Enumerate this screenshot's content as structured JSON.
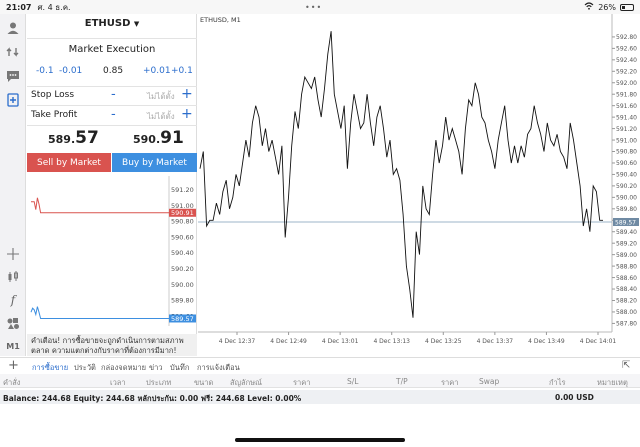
{
  "status": {
    "time": "21:07",
    "date": "ศ. 4 ธ.ค.",
    "battery": "26%",
    "dots": "•••"
  },
  "panel": {
    "symbol": "ETHUSD",
    "execution": "Market Execution",
    "vol_buttons": [
      "-0.1",
      "-0.01",
      "0.85",
      "+0.01",
      "+0.1"
    ],
    "stop_loss": {
      "label": "Stop Loss",
      "placeholder": "ไม่ได้ตั้ง",
      "minus": "-",
      "plus": "+"
    },
    "take_profit": {
      "label": "Take Profit",
      "placeholder": "ไม่ได้ตั้ง",
      "minus": "-",
      "plus": "+"
    },
    "sell_price": {
      "main": "589.",
      "big": "57"
    },
    "buy_price": {
      "main": "590.",
      "big": "91"
    },
    "sell_label": "Sell by Market",
    "buy_label": "Buy by Market",
    "warning": "คำเตือน! การซื้อขายจะถูกดำเนินการตามสภาพตลาด ความแตกต่างกับราคาที่ต้องการมีมาก!"
  },
  "mini_chart": {
    "ticks": [
      "591.20",
      "591.00",
      "590.80",
      "590.60",
      "590.40",
      "590.20",
      "590.00",
      "589.80",
      "589.60"
    ],
    "ask_label": "590.91",
    "bid_label": "589.57",
    "ylim": [
      589.5,
      591.3
    ],
    "ask_series": [
      591.05,
      591.05,
      591.05,
      590.95,
      591.1,
      591.02,
      590.91,
      590.91,
      590.91,
      590.91,
      590.91,
      590.91,
      590.91,
      590.91,
      590.91,
      590.91,
      590.91,
      590.91,
      590.91,
      590.91,
      590.91,
      590.91,
      590.91,
      590.91,
      590.91,
      590.91,
      590.91,
      590.91,
      590.91,
      590.91,
      590.91
    ],
    "bid_series": [
      589.65,
      589.7,
      589.68,
      589.62,
      589.72,
      589.65,
      589.57,
      589.57,
      589.57,
      589.57,
      589.57,
      589.57,
      589.57,
      589.57,
      589.57,
      589.57,
      589.57,
      589.57,
      589.57,
      589.57,
      589.57,
      589.57,
      589.57,
      589.57,
      589.57,
      589.57,
      589.57,
      589.57,
      589.57,
      589.57,
      589.57
    ],
    "ask_color": "#d9534f",
    "bid_color": "#3d8fe0"
  },
  "chart_data": {
    "type": "line",
    "title": "ETHUSD, M1",
    "ylim": [
      587.65,
      593.2
    ],
    "yticks": [
      "592.80",
      "592.60",
      "592.40",
      "592.20",
      "592.00",
      "591.80",
      "591.60",
      "591.40",
      "591.20",
      "591.00",
      "590.80",
      "590.60",
      "590.40",
      "590.20",
      "590.00",
      "589.80",
      "589.60",
      "589.40",
      "589.20",
      "589.00",
      "588.80",
      "588.60",
      "588.40",
      "588.20",
      "588.00",
      "587.80"
    ],
    "xticks": [
      "4 Dec 12:37",
      "4 Dec 12:49",
      "4 Dec 13:01",
      "4 Dec 13:13",
      "4 Dec 13:25",
      "4 Dec 13:37",
      "4 Dec 13:49",
      "4 Dec 14:01"
    ],
    "current_price": "589.57",
    "current_value": 589.57,
    "values": [
      590.5,
      590.8,
      589.5,
      589.6,
      589.6,
      589.9,
      589.7,
      590.1,
      590.3,
      589.8,
      590.0,
      590.4,
      590.2,
      590.6,
      591.0,
      590.7,
      591.3,
      591.6,
      591.4,
      590.9,
      591.2,
      590.8,
      591.0,
      590.7,
      590.4,
      590.9,
      589.3,
      590.0,
      590.9,
      591.5,
      591.2,
      591.8,
      592.1,
      592.0,
      591.9,
      592.1,
      591.7,
      591.4,
      591.9,
      592.5,
      592.9,
      591.8,
      591.5,
      591.2,
      591.6,
      590.5,
      591.3,
      591.8,
      591.5,
      591.2,
      591.3,
      591.8,
      591.3,
      590.9,
      591.4,
      591.6,
      591.2,
      590.7,
      591.0,
      590.4,
      590.5,
      590.3,
      589.7,
      588.8,
      588.4,
      587.9,
      589.4,
      589.0,
      590.2,
      589.8,
      589.7,
      590.4,
      591.0,
      590.6,
      590.9,
      591.4,
      591.0,
      591.2,
      591.0,
      590.8,
      590.4,
      591.2,
      591.7,
      591.6,
      592.0,
      591.8,
      591.4,
      591.3,
      591.0,
      590.8,
      590.5,
      591.0,
      591.3,
      591.6,
      591.0,
      590.6,
      590.9,
      590.6,
      590.9,
      590.7,
      591.1,
      591.2,
      591.6,
      591.3,
      591.1,
      590.8,
      591.3,
      591.0,
      590.9,
      591.1,
      590.8,
      590.7,
      590.5,
      591.3,
      591.0,
      590.6,
      590.2,
      589.5,
      589.8,
      589.4,
      590.2,
      590.1,
      589.6,
      589.6
    ],
    "line_color": "#111111",
    "price_line_color": "#9db4c8",
    "grid": false
  },
  "tabs": {
    "items": [
      "การซื้อขาย",
      "ประวัติ",
      "กล่องจดหมาย",
      "ข่าว",
      "บันทึก",
      "การแจ้งเตือน"
    ],
    "active": 0
  },
  "columns": [
    "คำสั่ง",
    "เวลา",
    "ประเภท",
    "ขนาด",
    "สัญลักษณ์",
    "ราคา",
    "S/L",
    "T/P",
    "ราคา",
    "Swap",
    "กำไร",
    "หมายเหตุ"
  ],
  "balance": {
    "text": "Balance: 244.68 Equity: 244.68 หลักประกัน: 0.00 ฟรี: 244.68 Level: 0.00%",
    "profit": "0.00",
    "currency": "USD"
  }
}
